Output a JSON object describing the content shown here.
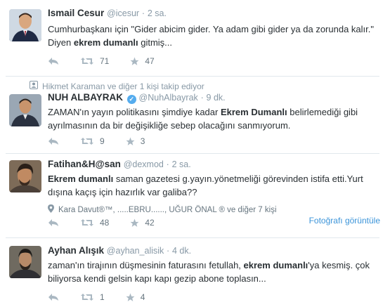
{
  "tweets": [
    {
      "fullname": "Ismail Cesur",
      "username": "@icesur",
      "time": "2 sa.",
      "text_parts": [
        {
          "t": "Cumhurbaşkanı için \"Gider abicim gider. Ya adam gibi gider ya da zorunda kalır.\" Diyen ",
          "b": false
        },
        {
          "t": "ekrem dumanlı",
          "b": true
        },
        {
          "t": " gitmiş...",
          "b": false
        }
      ],
      "retweets": "71",
      "favorites": "47"
    },
    {
      "context": "Hikmet Karaman ve diğer 1 kişi takip ediyor",
      "fullname": "NUH ALBAYRAK",
      "verified": true,
      "username": "@NuhAlbayrak",
      "time": "9 dk.",
      "text_parts": [
        {
          "t": "ZAMAN'ın yayın politikasını şimdiye kadar ",
          "b": false
        },
        {
          "t": "Ekrem Dumanlı",
          "b": true
        },
        {
          "t": " belirlemediği gibi ayrılmasının da bir değişikliğe sebep olacağını sanmıyorum.",
          "b": false
        }
      ],
      "retweets": "9",
      "favorites": "3"
    },
    {
      "fullname": "Fatihan&H@san",
      "username": "@dexmod",
      "time": "2 sa.",
      "text_parts": [
        {
          "t": "Ekrem dumanlı",
          "b": true
        },
        {
          "t": " saman gazetesi g.yayın.yönetmeliği görevinden istifa etti.Yurt dışına kaçış için hazırlık var galiba??",
          "b": false
        }
      ],
      "mentions": "Kara Davut®™, .....EBRU......, UĞUR ÖNAL ® ve diğer 7 kişi",
      "retweets": "48",
      "favorites": "42",
      "photo_link": "Fotoğrafı görüntüle"
    },
    {
      "fullname": "Ayhan Alışık",
      "username": "@ayhan_alisik",
      "time": "4 dk.",
      "text_parts": [
        {
          "t": "zaman'ın tirajının düşmesinin faturasını fetullah, ",
          "b": false
        },
        {
          "t": "ekrem dumanlı",
          "b": true
        },
        {
          "t": "'ya kesmiş. çok biliyorsa kendi gelsin kapı kapı gezip abone toplasın...",
          "b": false
        }
      ],
      "retweets": "1",
      "favorites": "4"
    }
  ],
  "separator": "·",
  "icons": {
    "reply": "reply-icon",
    "retweet": "retweet-icon",
    "favorite": "star-icon",
    "context": "follow-icon",
    "mentions": "location-pin-icon"
  },
  "colors": {
    "name": "#292f33",
    "meta": "#8899a6",
    "link": "#3b94d9",
    "verified": "#55acee",
    "divider": "#e1e8ed"
  }
}
